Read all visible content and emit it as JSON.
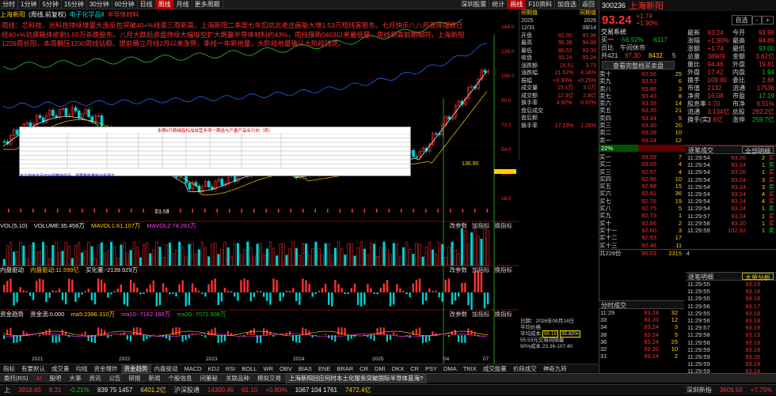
{
  "toolbar": {
    "items": [
      "分时",
      "1分钟",
      "5分钟",
      "15分钟",
      "30分钟",
      "60分钟",
      "日线",
      "周线",
      "月线",
      "更多周期"
    ],
    "right": [
      "深圳股票",
      "统计",
      "画线",
      "F10资料",
      "加自选",
      "返回"
    ],
    "active": "周线"
  },
  "title": {
    "name": "上海新阳",
    "period": "(周线,前复权)",
    "sector1": "电子化学品Ⅱ",
    "sector2": "半导体材料"
  },
  "notice": "周线：芯科技、光科技持续增量大涨反包突破40+%线底三周新高，上海新阳二季度七年扣坑北老庄画能大增1.53万短线客股东。七月快乐八八月涨降摆脱已经40+%坑底箱体收割1.55万杀跌股东。八月大跌后资盘持续大幅吸空扩大跑赢半导体材料约43%，周线摸新0403以来最低量。周线新高前期相同，上海新阳1226周长阳，本周翻压1230周线站稳。提前确立月线2月以来涨势，季线一年新地量，大阶段地量确认大阶段钱虎。",
  "mini_table": {
    "title": "本期5只精细指标加成营多项一期选与产量产品业行向（两）",
    "note": "可立刻走产品产业观察你的品，需要重新重新分析相关。"
  },
  "markers": {
    "high": "136.90",
    "low": "23.59"
  },
  "vol": {
    "label": "VOL(5,10)",
    "volume": "VOLUME:35.456万",
    "ma5": "MAVOL1:61.107万",
    "ma10": "MAVOL2:74.261万"
  },
  "drive": {
    "label": "内盘驱动",
    "v1": "内盘驱动:11.599亿",
    "v2": "买化量:-2139.929万"
  },
  "fund": {
    "label": "资金趋势",
    "v0": "资金流:0.000",
    "ma5": "ma5:2386.310万",
    "ma10": "ma10:-7162.189万",
    "ma20": "ma20:-7072.508万"
  },
  "subbtns": [
    "改参数",
    "加指标",
    "换指标",
    "+"
  ],
  "xaxis": [
    "2021",
    "2022",
    "2023",
    "2024",
    "2025",
    "04",
    "07"
  ],
  "price_axis": [
    "144.0",
    "126.0",
    "108.0",
    "90.0",
    "72.0",
    "54.0",
    "36.0",
    "18.0"
  ],
  "info_panel": {
    "head1": "同期值",
    "head2": "同期值",
    "date1": "2025",
    "date2": "2026",
    "d1b": "12/31",
    "d2b": "08/14",
    "rows": [
      [
        "开盘",
        "81.00",
        "93.96"
      ],
      [
        "最高",
        "95.38",
        "94.89"
      ],
      [
        "最低",
        "80.52",
        "93.00"
      ],
      [
        "收盘",
        "93.24",
        "93.24"
      ],
      [
        "涨跌额",
        "16.51",
        "3.73"
      ],
      [
        "涨跌幅",
        "21.52%",
        "4.16%"
      ],
      [
        "振幅",
        "+0.93%",
        "+0.25%"
      ],
      [
        "成交量",
        "15.1万",
        "3.0万"
      ],
      [
        "成交额",
        "12.3亿",
        "2.8亿"
      ],
      [
        "换手率",
        "4.92%",
        "0.97%"
      ],
      [
        "盘后成交",
        "",
        ""
      ],
      [
        "盘后额",
        "",
        ""
      ],
      [
        "换手率",
        "17.19%",
        "1.26%"
      ]
    ]
  },
  "chart_info": {
    "date": "日期：2026年08月14日",
    "avg": "平均价格",
    "cost_label": "平均成本",
    "cost": "96.16",
    "ratio": "35.82%",
    "trade": "55.53元交易间隔量",
    "range": "90%成本 23.36-107.40"
  },
  "bottom_tabs": [
    "指标",
    "有要默认",
    "成交量",
    "均线",
    "资金爆炸",
    "资金趋势",
    "内盘驱动",
    "MACD",
    "KDJ",
    "RSI",
    "BOLL",
    "WR",
    "OBV",
    "BIAS",
    "ENE",
    "BRAR",
    "CR",
    "DMI",
    "DKX",
    "CR",
    "PSY",
    "DMA",
    "TRIX",
    "成交能量",
    "价段成交",
    "神奇九转"
  ],
  "bottom_active": "资金趋势",
  "taskbar": [
    "委托(RS)",
    "AI",
    "股吧",
    "大事",
    "资讯",
    "公告",
    "研报",
    "新闻",
    "个股信息",
    "问董秘",
    "关联品种",
    "模拟交易"
  ],
  "taskbar_news": "上海新阳回应何时本土化服务突破国际半导体蓝海?",
  "status": {
    "idx1_name": "上",
    "idx1": "3918.65",
    "idx1_c": "8.31",
    "idx1_p": "-0.21%",
    "idx1_v": "839 75 1457",
    "idx1_a": "6401.2亿",
    "idx2_name": "沪深股通",
    "idx2": "14300.46",
    "idx2_c": "61.10",
    "idx2_p": "+0.80%",
    "idx2_v": "1067 104 1761",
    "idx2_a": "7472.4亿",
    "feed": "深圳新指",
    "feed_v": "3609.50",
    "feed_p": "+7.75%"
  },
  "right": {
    "code": "300236",
    "name": "上海新阳",
    "price": "93.24",
    "chg": "+1.74",
    "pct": "+1.90%",
    "tabs": [
      "自选",
      "-",
      "+"
    ],
    "info_label": "交易系统",
    "q1": "买一",
    "q1_p": "-56.92%",
    "q1_v": "-6117",
    "q2": "员比",
    "q2_v": "午间休市",
    "bid_price": "97.30",
    "bid_vol": "8432",
    "bid_n": "5",
    "btn": "查看完整档买卖盘",
    "fields": [
      [
        "最新",
        "93.24",
        "今开",
        "93.96"
      ],
      [
        "涨幅",
        "+1.90%",
        "最高",
        "94.89"
      ],
      [
        "涨额",
        "+1.74",
        "最低",
        "93.00"
      ],
      [
        "总量",
        "38909",
        "金额",
        "3.62亿"
      ],
      [
        "量比",
        "94.46",
        "外盘",
        "19.81"
      ],
      [
        "外盘",
        "17.42",
        "内盘",
        "1.94"
      ],
      [
        "换手",
        "109.80",
        "委比",
        "2.86"
      ],
      [
        "市值",
        "2132",
        "流通",
        "17536"
      ],
      [
        "净资",
        "16.08",
        "市盈",
        "17.19"
      ],
      [
        "股息率",
        "4.70",
        "市净",
        "9.51%"
      ],
      [
        "流通",
        "3.134亿",
        "总股",
        "292.2亿"
      ],
      [
        "换手(实)",
        "2.6亿",
        "涨停",
        "259.7亿"
      ]
    ],
    "sell": [
      [
        "卖十",
        "93.56",
        "25"
      ],
      [
        "卖九",
        "93.53",
        "6"
      ],
      [
        "卖八",
        "93.46",
        "3"
      ],
      [
        "卖七",
        "93.43",
        "8"
      ],
      [
        "卖六",
        "93.39",
        "14"
      ],
      [
        "卖五",
        "93.35",
        "21"
      ],
      [
        "卖四",
        "93.34",
        "5"
      ],
      [
        "卖三",
        "93.30",
        "20"
      ],
      [
        "卖二",
        "93.29",
        "10"
      ],
      [
        "卖一",
        "93.24",
        "12"
      ]
    ],
    "ratio_l": "22%",
    "ratio_r": "78%",
    "buy": [
      [
        "买一",
        "93.09",
        "7"
      ],
      [
        "买二",
        "93.05",
        "4"
      ],
      [
        "买三",
        "92.97",
        "4"
      ],
      [
        "买四",
        "92.96",
        "10"
      ],
      [
        "买五",
        "92.88",
        "15"
      ],
      [
        "买六",
        "92.81",
        "36"
      ],
      [
        "买七",
        "92.76",
        "19"
      ],
      [
        "买八",
        "92.75",
        "5"
      ],
      [
        "买九",
        "92.73",
        "1"
      ],
      [
        "买十",
        "92.66",
        "2"
      ],
      [
        "买十一",
        "92.60",
        "3"
      ],
      [
        "买十二",
        "92.53",
        "17"
      ],
      [
        "买十三",
        "92.46",
        "11"
      ]
    ],
    "last_big": "93.24",
    "trade_label": "逐笔成交",
    "trade_btn": "全部明细",
    "trades": [
      [
        "11:29:54",
        "93.20",
        "2"
      ],
      [
        "11:29:54",
        "93.24",
        "1"
      ],
      [
        "11:29:54",
        "93.20",
        "1"
      ],
      [
        "11:29:54",
        "93.24",
        "3"
      ],
      [
        "11:29:54",
        "93.24",
        "3"
      ],
      [
        "11:29:54",
        "93.24",
        "4"
      ],
      [
        "11:29:54",
        "93.24",
        "4"
      ],
      [
        "11:29:54",
        "93.24",
        "1"
      ],
      [
        "11:29:57",
        "93.24",
        "1"
      ],
      [
        "11:29:58",
        "93.20",
        "1"
      ],
      [
        "11:29:59",
        "102.92",
        "1"
      ]
    ],
    "detail_label": "逐笔明细",
    "detail_btn": "大单分析",
    "details": [
      [
        "11:29:55",
        "93.19"
      ],
      [
        "11:29:55",
        "93.18"
      ],
      [
        "11:29:55",
        "93.18"
      ],
      [
        "11:29:56",
        "93.17"
      ],
      [
        "11:29:55",
        "93.18"
      ],
      [
        "11:29:56",
        "93.19"
      ],
      [
        "11:29:57",
        "93.19"
      ],
      [
        "11:29:58",
        "93.19"
      ],
      [
        "11:29:58",
        "93.19"
      ],
      [
        "11:29:59",
        "93.19"
      ],
      [
        "11:29:59",
        "93.20"
      ],
      [
        "11:29:59",
        "93.24"
      ],
      [
        "11:29:59",
        "93.24"
      ]
    ],
    "summary": [
      "共228份",
      "90.03",
      "2315",
      "4"
    ],
    "fen_label": "分时成交",
    "fen_btn": "",
    "fens": [
      [
        "11:29",
        "93.24",
        "32"
      ],
      [
        "33",
        "93.20",
        "12"
      ],
      [
        "34",
        "93.24",
        "3"
      ],
      [
        "38",
        "93.24",
        "5"
      ],
      [
        "36",
        "93.24",
        "25"
      ],
      [
        "32",
        "93.20",
        "10"
      ],
      [
        "31",
        "93.24",
        "2"
      ]
    ]
  }
}
